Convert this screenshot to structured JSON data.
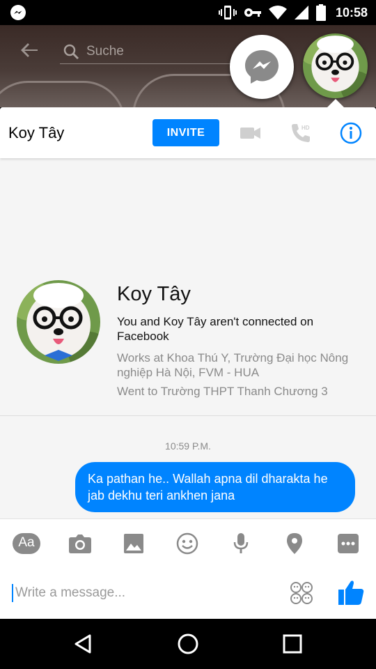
{
  "status_bar": {
    "time": "10:58"
  },
  "background_app": {
    "search_placeholder": "Suche"
  },
  "header": {
    "contact_name": "Koy Tây",
    "invite_label": "INVITE"
  },
  "profile": {
    "name": "Koy Tây",
    "connection_status": "You and Koy Tây aren't connected on Facebook",
    "works_at": "Works at Khoa Thú Y, Trường Đại học Nông nghiệp Hà Nội, FVM - HUA",
    "education": "Went to Trường THPT Thanh Chương 3"
  },
  "conversation": {
    "timestamp": "10:59 P.M.",
    "messages": [
      {
        "sender": "me",
        "text": "Ka pathan he.. Wallah apna dil dharakta he jab dekhu teri ankhen jana"
      }
    ]
  },
  "composer": {
    "font_button_label": "Aa",
    "placeholder": "Write a message..."
  },
  "colors": {
    "accent": "#0084ff",
    "disabled_icon": "#cfcfcf",
    "toolbar_icon": "#8a8a8a"
  }
}
